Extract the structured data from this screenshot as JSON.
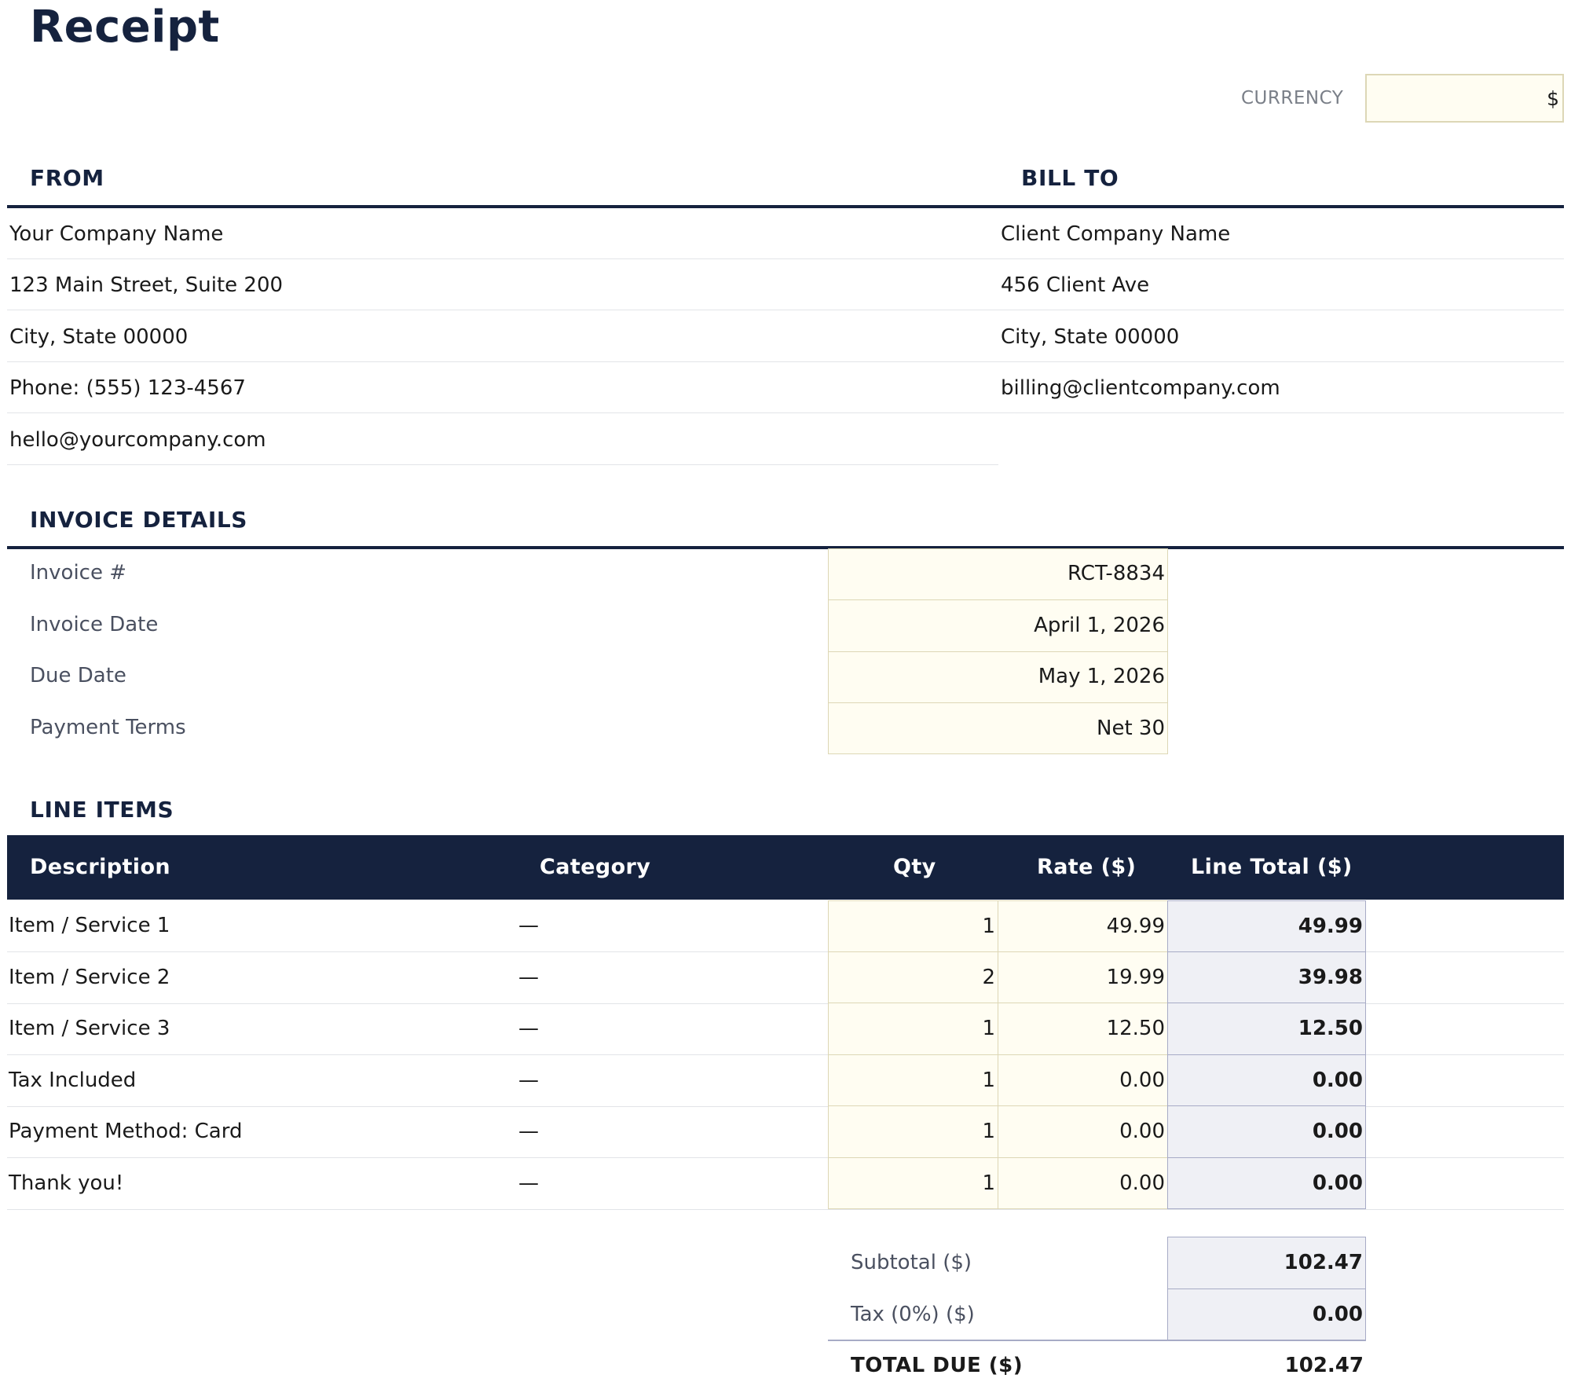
{
  "title": "Receipt",
  "currency": {
    "label": "CURRENCY",
    "value": "$"
  },
  "from": {
    "heading": "FROM",
    "lines": [
      "Your Company Name",
      "123 Main Street, Suite 200",
      "City, State 00000",
      "Phone: (555) 123-4567",
      "hello@yourcompany.com"
    ]
  },
  "bill_to": {
    "heading": "BILL TO",
    "lines": [
      "Client Company Name",
      "456 Client Ave",
      "City, State 00000",
      "billing@clientcompany.com"
    ]
  },
  "invoice_details": {
    "heading": "INVOICE DETAILS",
    "fields": [
      {
        "label": "Invoice #",
        "value": "RCT-8834"
      },
      {
        "label": "Invoice Date",
        "value": "April 1, 2026"
      },
      {
        "label": "Due Date",
        "value": "May 1, 2026"
      },
      {
        "label": "Payment Terms",
        "value": "Net 30"
      }
    ]
  },
  "line_items": {
    "heading": "LINE ITEMS",
    "columns": [
      "Description",
      "Category",
      "Qty",
      "Rate ($)",
      "Line Total ($)"
    ],
    "rows": [
      {
        "description": "Item / Service 1",
        "category": "—",
        "qty": "1",
        "rate": "49.99",
        "total": "49.99"
      },
      {
        "description": "Item / Service 2",
        "category": "—",
        "qty": "2",
        "rate": "19.99",
        "total": "39.98"
      },
      {
        "description": "Item / Service 3",
        "category": "—",
        "qty": "1",
        "rate": "12.50",
        "total": "12.50"
      },
      {
        "description": "Tax Included",
        "category": "—",
        "qty": "1",
        "rate": "0.00",
        "total": "0.00"
      },
      {
        "description": "Payment Method: Card",
        "category": "—",
        "qty": "1",
        "rate": "0.00",
        "total": "0.00"
      },
      {
        "description": "Thank you!",
        "category": "—",
        "qty": "1",
        "rate": "0.00",
        "total": "0.00"
      }
    ]
  },
  "totals": {
    "subtotal_label": "Subtotal ($)",
    "subtotal": "102.47",
    "tax_label": "Tax (0%) ($)",
    "tax": "0.00",
    "total_label": "TOTAL DUE ($)",
    "total": "102.47"
  }
}
